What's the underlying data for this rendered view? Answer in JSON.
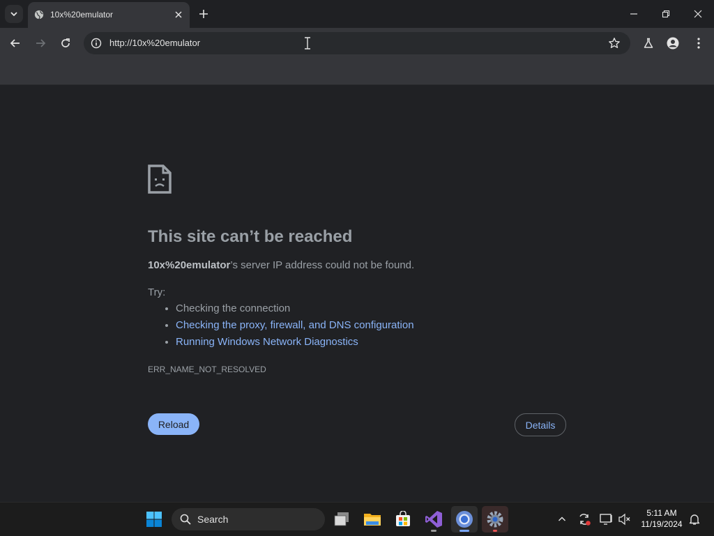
{
  "tab": {
    "title": "10x%20emulator"
  },
  "omnibox": {
    "url": "http://10x%20emulator"
  },
  "error": {
    "heading": "This site can’t be reached",
    "host": "10x%20emulator",
    "message_suffix": "’s server IP address could not be found.",
    "try_label": "Try:",
    "suggestions": [
      "Checking the connection",
      "Checking the proxy, firewall, and DNS configuration",
      "Running Windows Network Diagnostics"
    ],
    "code": "ERR_NAME_NOT_RESOLVED"
  },
  "buttons": {
    "reload": "Reload",
    "details": "Details"
  },
  "taskbar": {
    "search_label": "Search",
    "time": "5:11 AM",
    "date": "11/19/2024"
  },
  "colors": {
    "accent": "#8ab4f8",
    "page_background": "#202124",
    "chrome_frame": "#1f2023",
    "toolbar": "#35363a"
  }
}
